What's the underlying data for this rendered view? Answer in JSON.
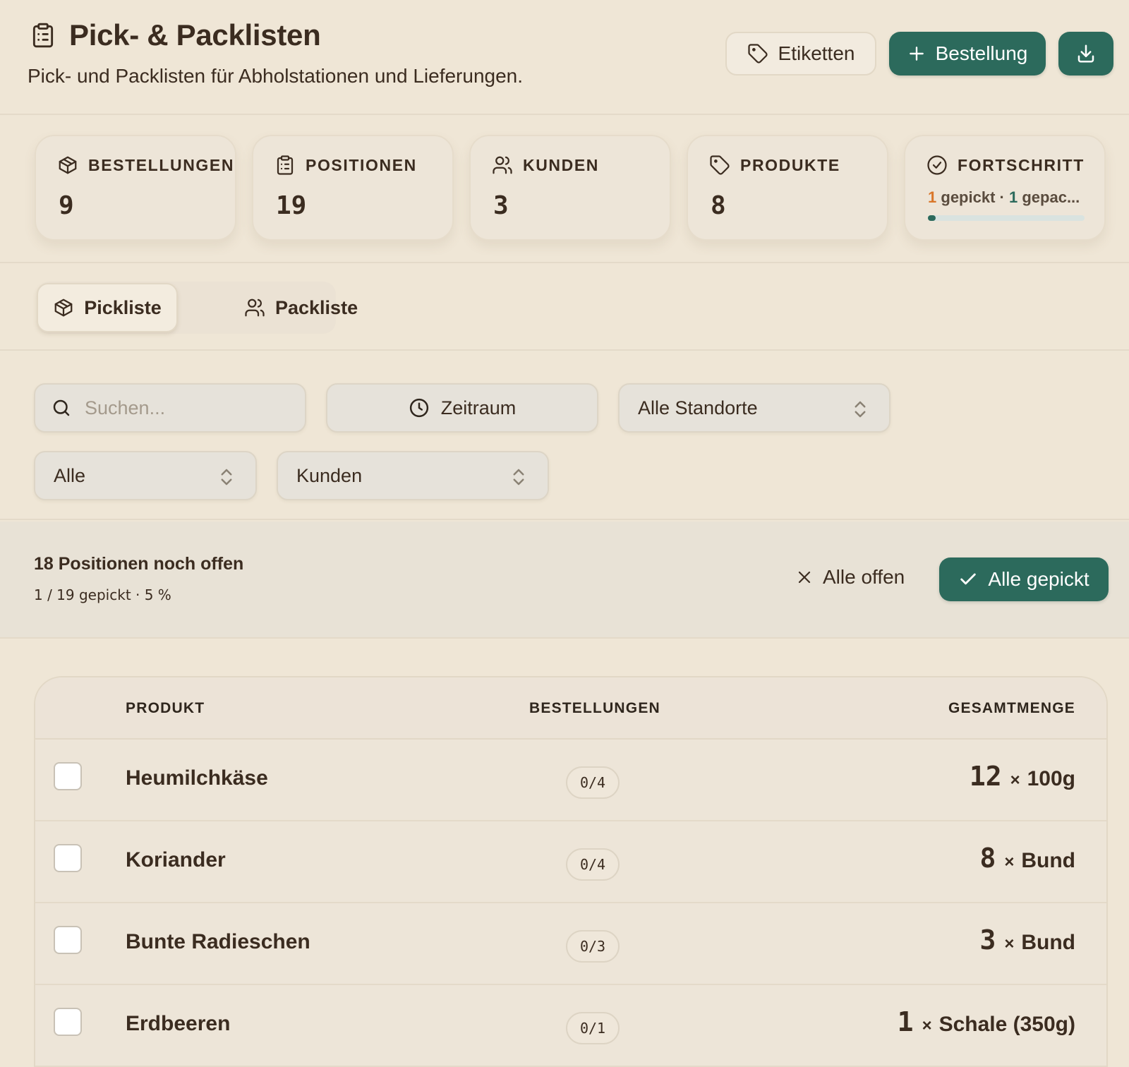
{
  "header": {
    "title": "Pick- & Packlisten",
    "subtitle": "Pick- und Packlisten für Abholstationen und Lieferungen.",
    "labels_button": "Etiketten",
    "order_button": "Bestellung",
    "download_icon": "download-icon"
  },
  "stats": {
    "orders": {
      "label": "BESTELLUNGEN",
      "value": "9",
      "icon": "package-icon"
    },
    "positions": {
      "label": "POSITIONEN",
      "value": "19",
      "icon": "clipboard-icon"
    },
    "customers": {
      "label": "KUNDEN",
      "value": "3",
      "icon": "users-icon"
    },
    "products": {
      "label": "PRODUKTE",
      "value": "8",
      "icon": "tag-icon"
    },
    "progress": {
      "label": "FORTSCHRITT",
      "picked_count": "1",
      "picked_label": "gepickt",
      "separator": "·",
      "packed_count": "1",
      "packed_label": "gepac...",
      "fraction": 0.05,
      "icon": "check-circle-icon"
    }
  },
  "tabs": [
    {
      "label": "Pickliste",
      "active": true,
      "icon": "package-icon"
    },
    {
      "label": "Packliste",
      "active": false,
      "icon": "users-icon"
    }
  ],
  "filters": {
    "search_placeholder": "Suchen...",
    "period_label": "Zeitraum",
    "location_value": "Alle Standorte",
    "status_value": "Alle",
    "group_value": "Kunden"
  },
  "summary": {
    "title": "18 Positionen noch offen",
    "subtitle": "1 / 19 gepickt · 5 %",
    "all_open_label": "Alle offen",
    "all_picked_label": "Alle gepickt"
  },
  "table": {
    "headers": {
      "product": "PRODUKT",
      "orders": "BESTELLUNGEN",
      "total": "GESAMTMENGE"
    },
    "rows": [
      {
        "product": "Heumilchkäse",
        "orders": "0/4",
        "qty": "12",
        "times": "×",
        "unit": "100g",
        "checked": false
      },
      {
        "product": "Koriander",
        "orders": "0/4",
        "qty": "8",
        "times": "×",
        "unit": "Bund",
        "checked": false
      },
      {
        "product": "Bunte Radieschen",
        "orders": "0/3",
        "qty": "3",
        "times": "×",
        "unit": "Bund",
        "checked": false
      },
      {
        "product": "Erdbeeren",
        "orders": "0/1",
        "qty": "1",
        "times": "×",
        "unit": "Schale (350g)",
        "checked": false
      }
    ]
  },
  "colors": {
    "background": "#efe6d6",
    "accent_green": "#2c6a5c",
    "accent_orange": "#d9772a",
    "text": "#3b2c20"
  }
}
